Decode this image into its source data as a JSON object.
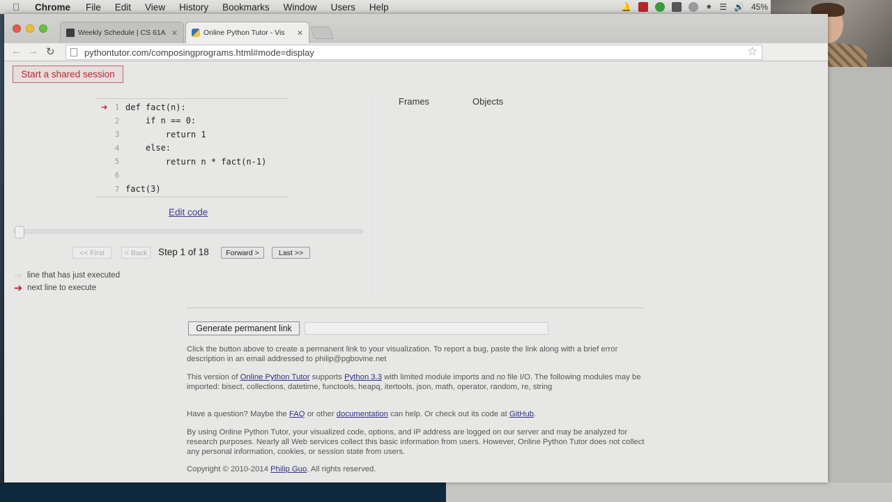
{
  "menubar": {
    "app": "Chrome",
    "items": [
      "File",
      "Edit",
      "View",
      "History",
      "Bookmarks",
      "Window",
      "Users",
      "Help"
    ],
    "battery": "45%"
  },
  "tabs": [
    {
      "title": "Weekly Schedule | CS 61A",
      "active": false
    },
    {
      "title": "Online Python Tutor - Vis",
      "active": true
    }
  ],
  "address_bar": {
    "url": "pythontutor.com/composingprograms.html#mode=display"
  },
  "page": {
    "shared_session_button": "Start a shared session",
    "code_lines": [
      {
        "num": "1",
        "text": "def fact(n):",
        "current": true
      },
      {
        "num": "2",
        "text": "    if n == 0:",
        "current": false
      },
      {
        "num": "3",
        "text": "        return 1",
        "current": false
      },
      {
        "num": "4",
        "text": "    else:",
        "current": false
      },
      {
        "num": "5",
        "text": "        return n * fact(n-1)",
        "current": false
      },
      {
        "num": "6",
        "text": "",
        "current": false
      },
      {
        "num": "7",
        "text": "fact(3)",
        "current": false
      }
    ],
    "edit_code": "Edit code",
    "nav": {
      "first": "<< First",
      "back": "< Back",
      "step_text": "Step 1 of 18",
      "forward": "Forward >",
      "last": "Last >>"
    },
    "progress": {
      "step": 1,
      "total": 18
    },
    "legend": {
      "executed": "line that has just executed",
      "next": "next line to execute"
    },
    "frames_header": "Frames",
    "objects_header": "Objects",
    "generate_link_button": "Generate permanent link",
    "para1": "Click the button above to create a permanent link to your visualization. To report a bug, paste the link along with a brief error description in an email addressed to philip@pgbovine.net",
    "para2": {
      "pre": "This version of ",
      "link1": "Online Python Tutor",
      "mid": " supports ",
      "link2": "Python 3.3",
      "post": " with limited module imports and no file I/O. The following modules may be imported: bisect, collections, datetime, functools, heapq, itertools, json, math, operator, random, re, string"
    },
    "para3": {
      "pre": "Have a question? Maybe the ",
      "faq": "FAQ",
      "mid1": " or other ",
      "docs": "documentation",
      "mid2": " can help. Or check out its code at ",
      "github": "GitHub",
      "post": "."
    },
    "para4": "By using Online Python Tutor, your visualized code, options, and IP address are logged on our server and may be analyzed for research purposes. Nearly all Web services collect this basic information from users. However, Online Python Tutor does not collect any personal information, cookies, or session state from users.",
    "copyright": {
      "pre": "Copyright © 2010-2014 ",
      "author": "Philip Guo",
      "post": ". All rights reserved."
    }
  }
}
